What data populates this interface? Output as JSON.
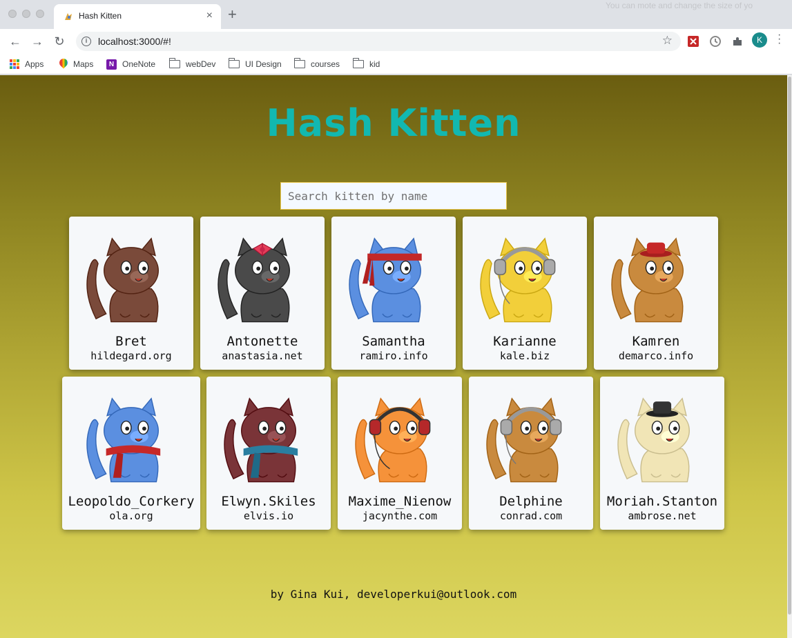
{
  "browser": {
    "tab_title": "Hash Kitten",
    "tab_close": "×",
    "new_tab": "+",
    "ghost_text": "You can mote and change the size of yo",
    "url": "localhost:3000/#!",
    "profile_initial": "K",
    "bookmarks": [
      "Apps",
      "Maps",
      "OneNote",
      "webDev",
      "UI Design",
      "courses",
      "kid"
    ]
  },
  "page": {
    "title": "Hash Kitten",
    "search_placeholder": "Search kitten by name",
    "footer": "by Gina Kui, developerkui@outlook.com"
  },
  "kittens": [
    {
      "name": "Bret",
      "email": "hildegard.org",
      "body_color": "#7a4a3a",
      "eye_color": "#ffffff",
      "accessory": "none"
    },
    {
      "name": "Antonette",
      "email": "anastasia.net",
      "body_color": "#4a4a4a",
      "eye_color": "#ffffff",
      "accessory": "bow"
    },
    {
      "name": "Samantha",
      "email": "ramiro.info",
      "body_color": "#5b8fe0",
      "eye_color": "#ffffff",
      "accessory": "headband"
    },
    {
      "name": "Karianne",
      "email": "kale.biz",
      "body_color": "#f2cf3a",
      "eye_color": "#ffffff",
      "accessory": "headphones"
    },
    {
      "name": "Kamren",
      "email": "demarco.info",
      "body_color": "#c98a3e",
      "eye_color": "#ffffff",
      "accessory": "hat-red"
    },
    {
      "name": "Leopoldo_Corkery",
      "email": "ola.org",
      "body_color": "#5b8fe0",
      "eye_color": "#ffffff",
      "accessory": "scarf-red"
    },
    {
      "name": "Elwyn.Skiles",
      "email": "elvis.io",
      "body_color": "#7a3438",
      "eye_color": "#ffffff",
      "accessory": "scarf-blue"
    },
    {
      "name": "Maxime_Nienow",
      "email": "jacynthe.com",
      "body_color": "#f5923a",
      "eye_color": "#ffffff",
      "accessory": "headphones-red"
    },
    {
      "name": "Delphine",
      "email": "conrad.com",
      "body_color": "#c98a3e",
      "eye_color": "#ffffff",
      "accessory": "headphones"
    },
    {
      "name": "Moriah.Stanton",
      "email": "ambrose.net",
      "body_color": "#f1e5b6",
      "eye_color": "#ffffff",
      "accessory": "hat-black"
    }
  ]
}
